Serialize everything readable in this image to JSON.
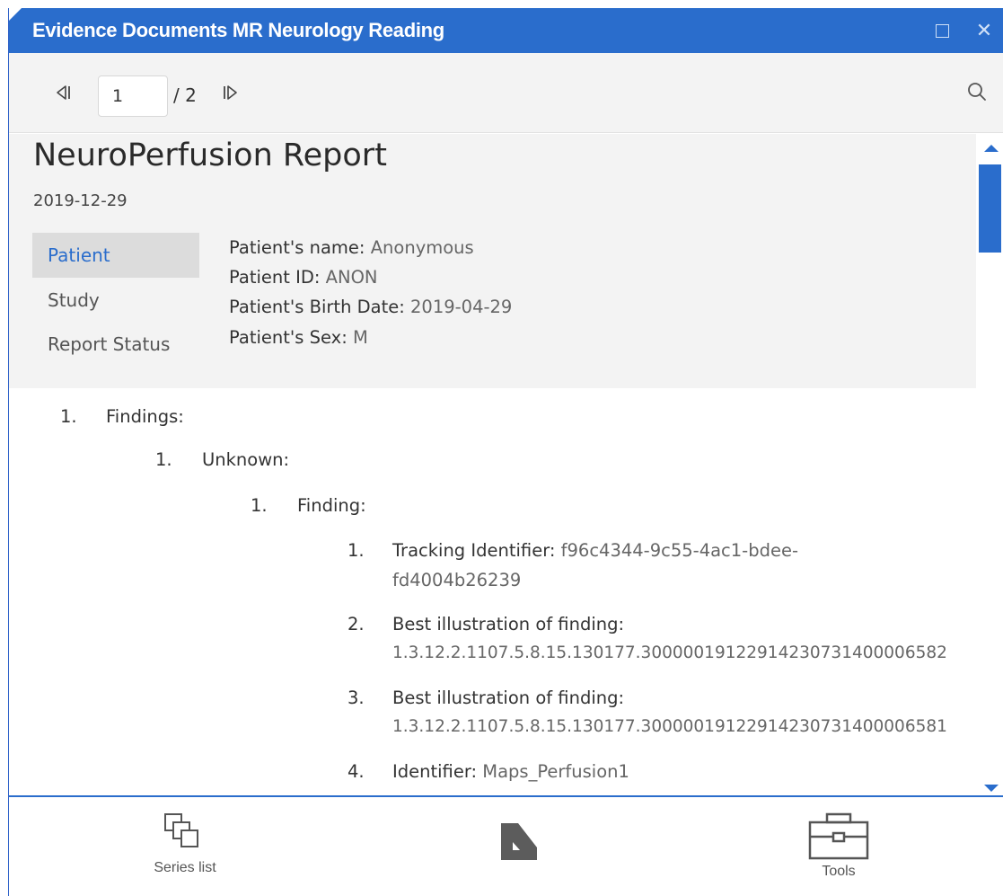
{
  "window": {
    "title": "Evidence Documents MR Neurology Reading"
  },
  "nav": {
    "page_value": "1",
    "page_total": "/ 2"
  },
  "report": {
    "title": "NeuroPerfusion Report",
    "date": "2019-12-29",
    "tabs": [
      {
        "label": "Patient",
        "active": true
      },
      {
        "label": "Study",
        "active": false
      },
      {
        "label": "Report Status",
        "active": false
      }
    ],
    "patient": [
      {
        "label": "Patient's name:",
        "value": "Anonymous"
      },
      {
        "label": "Patient ID:",
        "value": "ANON"
      },
      {
        "label": "Patient's Birth Date:",
        "value": "2019-04-29"
      },
      {
        "label": "Patient's Sex:",
        "value": "M"
      }
    ]
  },
  "findings": {
    "l1": {
      "num": "1.",
      "label": "Findings:"
    },
    "l2": {
      "num": "1.",
      "label": "Unknown:"
    },
    "l3": {
      "num": "1.",
      "label": "Finding:"
    },
    "items": [
      {
        "num": "1.",
        "label": "Tracking Identifier:",
        "value": "f96c4344-9c55-4ac1-bdee-",
        "value2": "fd4004b26239"
      },
      {
        "num": "2.",
        "label": "Best illustration of finding:",
        "value": "",
        "value2": "1.3.12.2.1107.5.8.15.130177.30000019122914230731400006582"
      },
      {
        "num": "3.",
        "label": "Best illustration of finding:",
        "value": "",
        "value2": "1.3.12.2.1107.5.8.15.130177.30000019122914230731400006581"
      },
      {
        "num": "4.",
        "label": "Identifier:",
        "value": "Maps_Perfusion1",
        "value2": ""
      }
    ]
  },
  "toolbar": {
    "series_label": "Series list",
    "tools_label": "Tools"
  },
  "icons": {
    "prev": "skip-previous-icon",
    "next": "skip-next-icon",
    "search": "search-icon",
    "series": "series-list-icon",
    "logo": "app-logo-icon",
    "tools": "toolbox-icon"
  },
  "colors": {
    "accent": "#2a6dcc",
    "panel": "#f3f3f3",
    "active_tab": "#dcdcdc"
  }
}
